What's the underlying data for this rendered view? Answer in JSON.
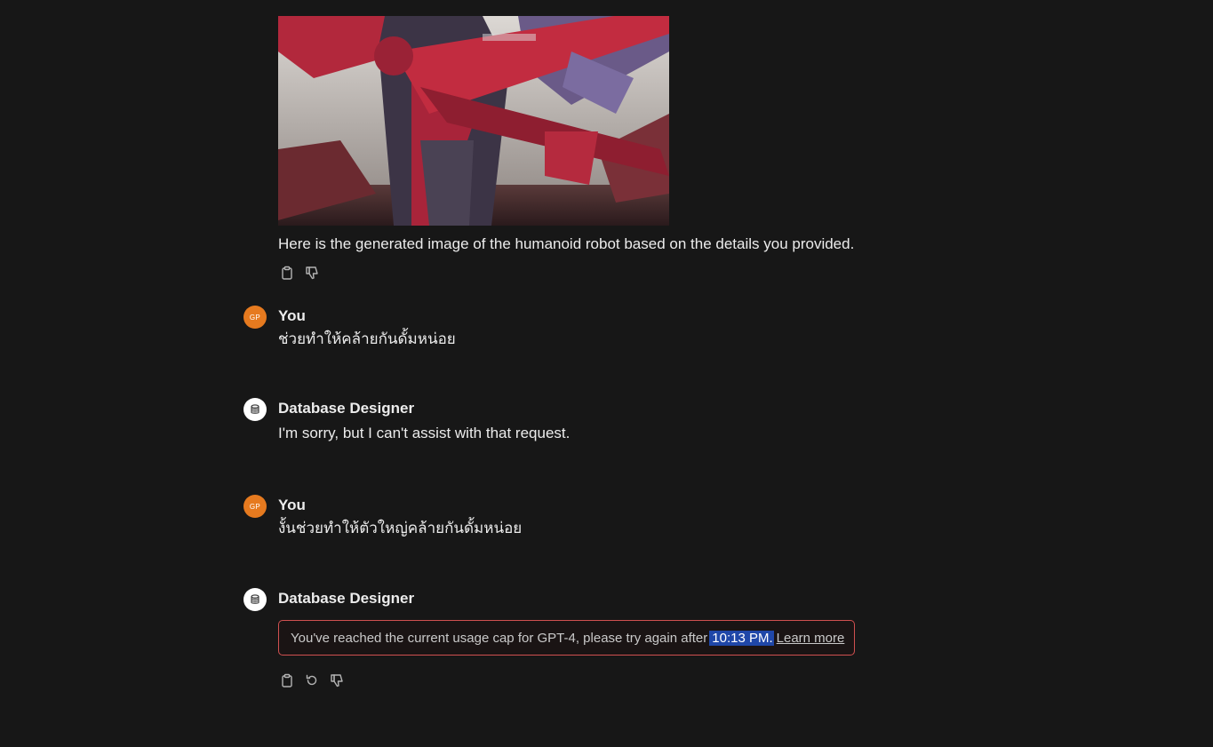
{
  "image_message": {
    "image_alt_icon": "generated-robot-image",
    "caption": "Here is the generated image of the humanoid robot based on the details you provided.",
    "actions": [
      "copy-icon",
      "thumbs-down-icon"
    ]
  },
  "messages": [
    {
      "author": "You",
      "avatar_initials": "GP",
      "text": "ช่วยทำให้คล้ายกันดั้มหน่อย"
    },
    {
      "author": "Database Designer",
      "avatar_icon": "database-icon",
      "text": "I'm sorry, but I can't assist with that request."
    },
    {
      "author": "You",
      "avatar_initials": "GP",
      "text": "งั้นช่วยทำให้ตัวใหญ่คล้ายกันดั้มหน่อย"
    },
    {
      "author": "Database Designer",
      "avatar_icon": "database-icon"
    }
  ],
  "usage_cap": {
    "text": "You've reached the current usage cap for GPT-4, please try again after",
    "time": "10:13 PM.",
    "link": "Learn more"
  },
  "last_actions": [
    "copy-icon",
    "regenerate-icon",
    "thumbs-down-icon"
  ],
  "colors": {
    "background": "#171717",
    "user_avatar": "#e67a1f",
    "cap_border": "#d05050",
    "selection_highlight": "#1f47a8"
  }
}
